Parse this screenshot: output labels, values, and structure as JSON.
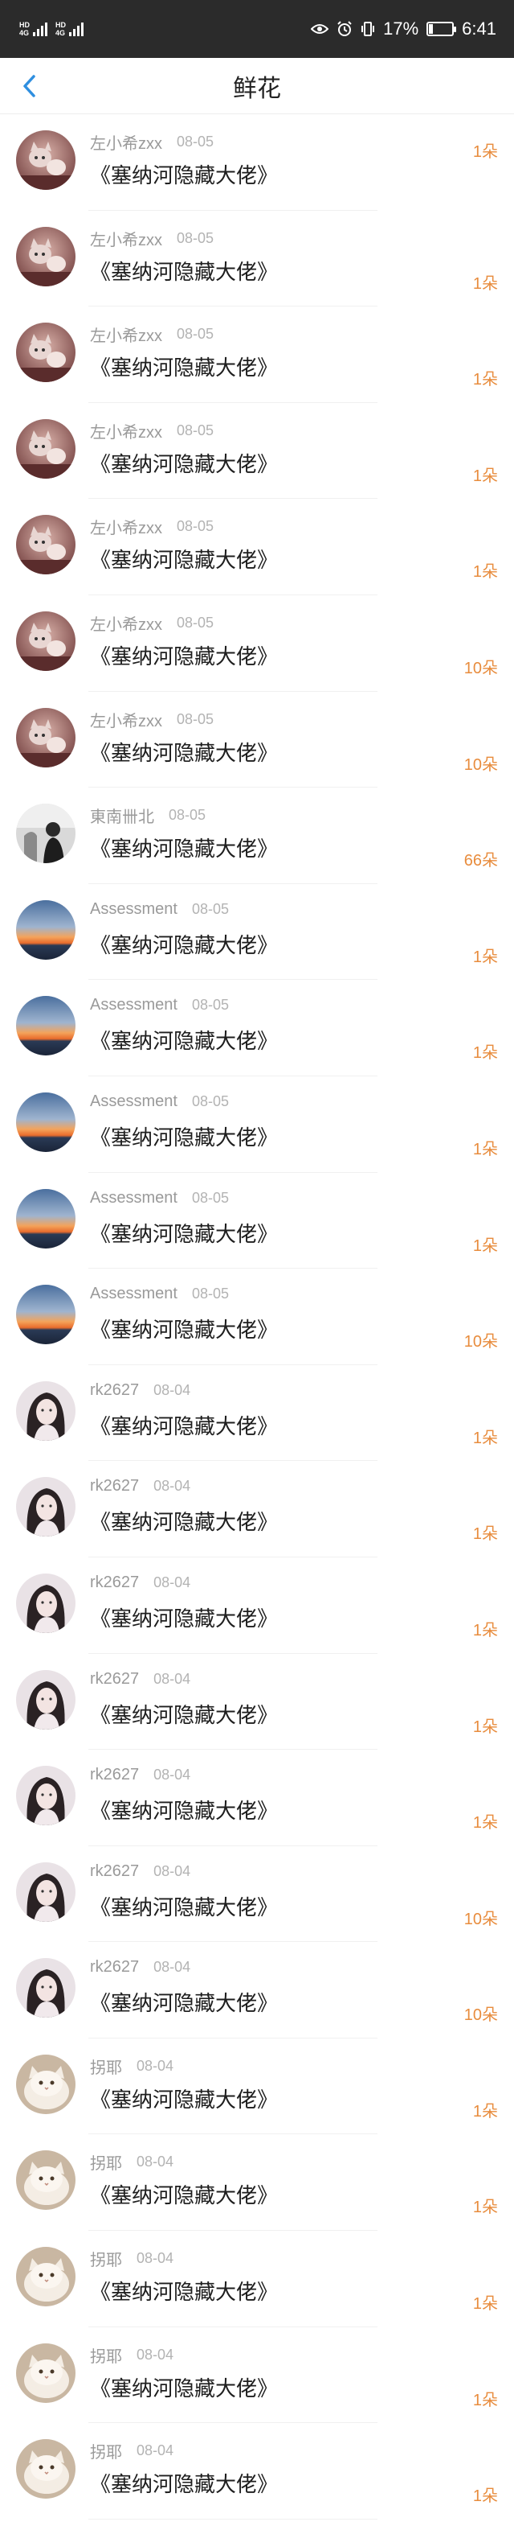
{
  "status_bar": {
    "network_left": "HD",
    "network_label": "4G",
    "battery": "17%",
    "battery_level": 0.17,
    "time": "6:41",
    "icons": [
      "eye-icon",
      "alarm-icon",
      "vibrate-icon",
      "battery-icon"
    ]
  },
  "nav": {
    "title": "鲜花",
    "back_icon": "chevron-left-icon",
    "accent": "#2f8fe0"
  },
  "colors": {
    "count": "#e88c3d",
    "username": "#9a9a9a"
  },
  "items": [
    {
      "user": "左小希zxx",
      "date": "08-05",
      "title": "《塞纳河隐藏大佬》",
      "count": "1朵",
      "avatar": "cat-portrait"
    },
    {
      "user": "左小希zxx",
      "date": "08-05",
      "title": "《塞纳河隐藏大佬》",
      "count": "1朵",
      "avatar": "cat-portrait"
    },
    {
      "user": "左小希zxx",
      "date": "08-05",
      "title": "《塞纳河隐藏大佬》",
      "count": "1朵",
      "avatar": "cat-portrait"
    },
    {
      "user": "左小希zxx",
      "date": "08-05",
      "title": "《塞纳河隐藏大佬》",
      "count": "1朵",
      "avatar": "cat-portrait"
    },
    {
      "user": "左小希zxx",
      "date": "08-05",
      "title": "《塞纳河隐藏大佬》",
      "count": "1朵",
      "avatar": "cat-portrait"
    },
    {
      "user": "左小希zxx",
      "date": "08-05",
      "title": "《塞纳河隐藏大佬》",
      "count": "10朵",
      "avatar": "cat-portrait"
    },
    {
      "user": "左小希zxx",
      "date": "08-05",
      "title": "《塞纳河隐藏大佬》",
      "count": "10朵",
      "avatar": "cat-portrait"
    },
    {
      "user": "東南卌北",
      "date": "08-05",
      "title": "《塞纳河隐藏大佬》",
      "count": "66朵",
      "avatar": "bw-figure"
    },
    {
      "user": "Assessment",
      "date": "08-05",
      "title": "《塞纳河隐藏大佬》",
      "count": "1朵",
      "avatar": "sunset"
    },
    {
      "user": "Assessment",
      "date": "08-05",
      "title": "《塞纳河隐藏大佬》",
      "count": "1朵",
      "avatar": "sunset"
    },
    {
      "user": "Assessment",
      "date": "08-05",
      "title": "《塞纳河隐藏大佬》",
      "count": "1朵",
      "avatar": "sunset"
    },
    {
      "user": "Assessment",
      "date": "08-05",
      "title": "《塞纳河隐藏大佬》",
      "count": "1朵",
      "avatar": "sunset"
    },
    {
      "user": "Assessment",
      "date": "08-05",
      "title": "《塞纳河隐藏大佬》",
      "count": "10朵",
      "avatar": "sunset"
    },
    {
      "user": "rk2627",
      "date": "08-04",
      "title": "《塞纳河隐藏大佬》",
      "count": "1朵",
      "avatar": "girl"
    },
    {
      "user": "rk2627",
      "date": "08-04",
      "title": "《塞纳河隐藏大佬》",
      "count": "1朵",
      "avatar": "girl"
    },
    {
      "user": "rk2627",
      "date": "08-04",
      "title": "《塞纳河隐藏大佬》",
      "count": "1朵",
      "avatar": "girl"
    },
    {
      "user": "rk2627",
      "date": "08-04",
      "title": "《塞纳河隐藏大佬》",
      "count": "1朵",
      "avatar": "girl"
    },
    {
      "user": "rk2627",
      "date": "08-04",
      "title": "《塞纳河隐藏大佬》",
      "count": "1朵",
      "avatar": "girl"
    },
    {
      "user": "rk2627",
      "date": "08-04",
      "title": "《塞纳河隐藏大佬》",
      "count": "10朵",
      "avatar": "girl"
    },
    {
      "user": "rk2627",
      "date": "08-04",
      "title": "《塞纳河隐藏大佬》",
      "count": "10朵",
      "avatar": "girl"
    },
    {
      "user": "拐耶",
      "date": "08-04",
      "title": "《塞纳河隐藏大佬》",
      "count": "1朵",
      "avatar": "kitten"
    },
    {
      "user": "拐耶",
      "date": "08-04",
      "title": "《塞纳河隐藏大佬》",
      "count": "1朵",
      "avatar": "kitten"
    },
    {
      "user": "拐耶",
      "date": "08-04",
      "title": "《塞纳河隐藏大佬》",
      "count": "1朵",
      "avatar": "kitten"
    },
    {
      "user": "拐耶",
      "date": "08-04",
      "title": "《塞纳河隐藏大佬》",
      "count": "1朵",
      "avatar": "kitten"
    },
    {
      "user": "拐耶",
      "date": "08-04",
      "title": "《塞纳河隐藏大佬》",
      "count": "1朵",
      "avatar": "kitten"
    }
  ]
}
